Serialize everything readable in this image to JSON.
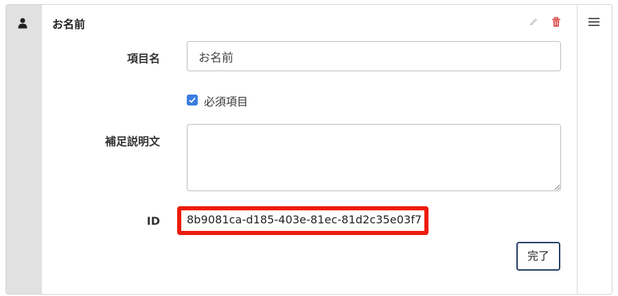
{
  "panel": {
    "title": "お名前",
    "icons": {
      "left": "person-icon",
      "edit": "pencil-icon",
      "delete": "trash-icon",
      "drag": "menu-icon"
    }
  },
  "fields": {
    "item_name_label": "項目名",
    "item_name_value": "お名前",
    "required_label": "必須項目",
    "required_checked": true,
    "description_label": "補足説明文",
    "description_value": "",
    "id_label": "ID",
    "id_value": "8b9081ca-d185-403e-81ec-81d2c35e03f7"
  },
  "actions": {
    "done_label": "完了"
  },
  "colors": {
    "accent": "#3a7ee0",
    "highlight": "#ee1c0b",
    "delete": "#d9534f",
    "button_border": "#1e3a5f"
  }
}
